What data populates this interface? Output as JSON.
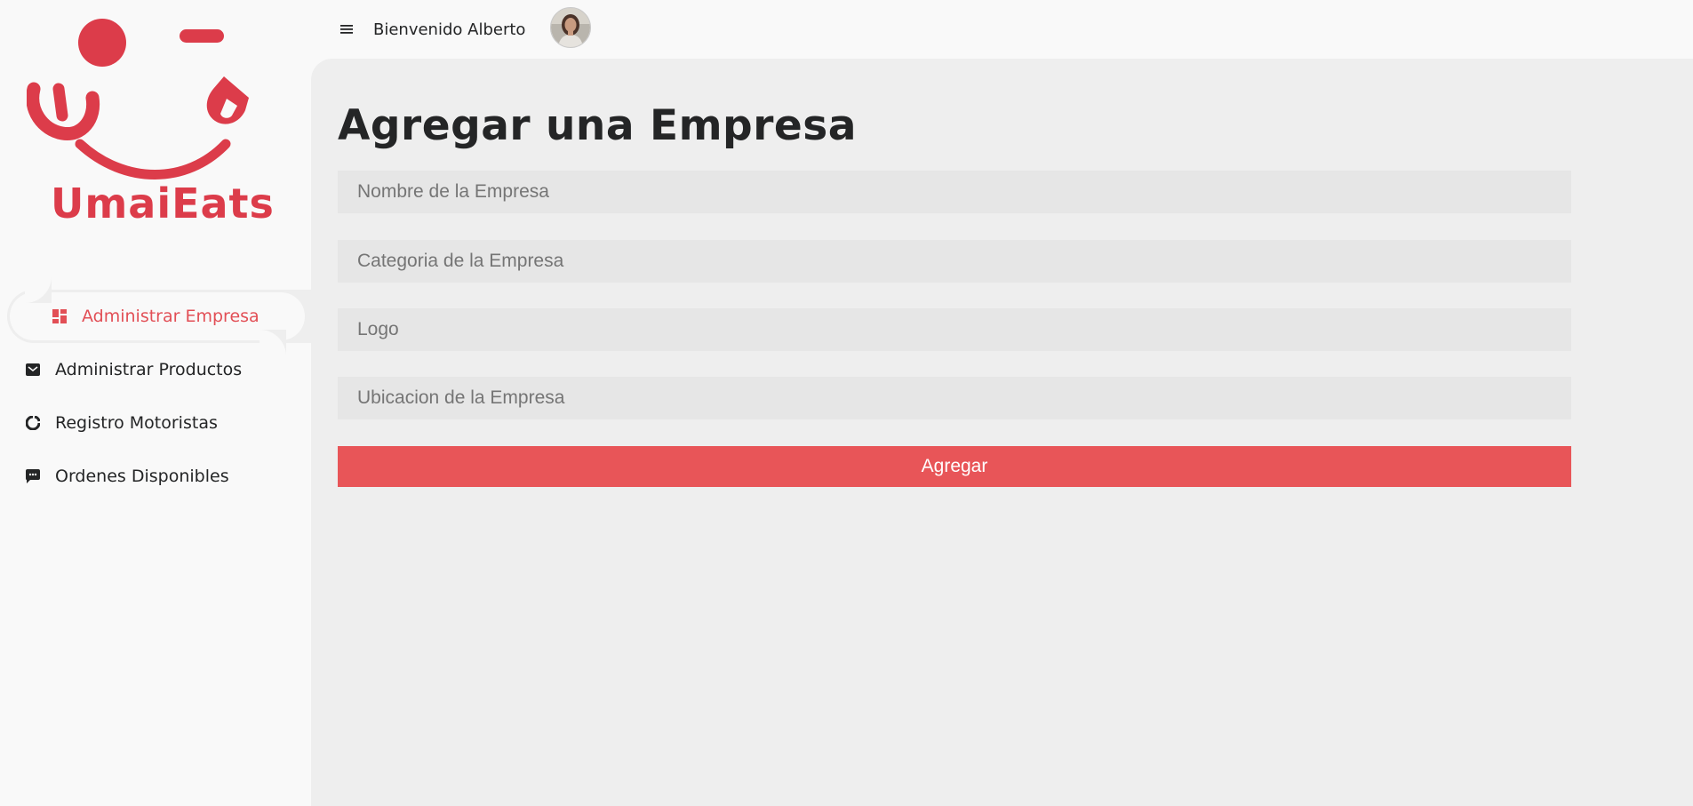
{
  "brand": {
    "name": "UmaiEats",
    "color": "#dc3c4a"
  },
  "topbar": {
    "welcome": "Bienvenido Alberto",
    "menu_icon": "hamburger-icon"
  },
  "sidebar": {
    "items": [
      {
        "label": "Administrar Empresa",
        "icon": "dashboard-icon",
        "active": true
      },
      {
        "label": "Administrar Productos",
        "icon": "mail-icon",
        "active": false
      },
      {
        "label": "Registro Motoristas",
        "icon": "pie-chart-icon",
        "active": false
      },
      {
        "label": "Ordenes Disponibles",
        "icon": "message-icon",
        "active": false
      }
    ]
  },
  "main": {
    "title": "Agregar una Empresa",
    "form": {
      "fields": [
        {
          "placeholder": "Nombre de la Empresa",
          "value": ""
        },
        {
          "placeholder": "Categoria de la Empresa",
          "value": ""
        },
        {
          "placeholder": "Logo",
          "value": ""
        },
        {
          "placeholder": "Ubicacion de la Empresa",
          "value": ""
        }
      ],
      "submit_label": "Agregar"
    }
  },
  "colors": {
    "accent": "#e85558",
    "active_text": "#e24f56",
    "main_bg": "#eeeeee",
    "sidebar_bg": "#f9f9f9"
  }
}
